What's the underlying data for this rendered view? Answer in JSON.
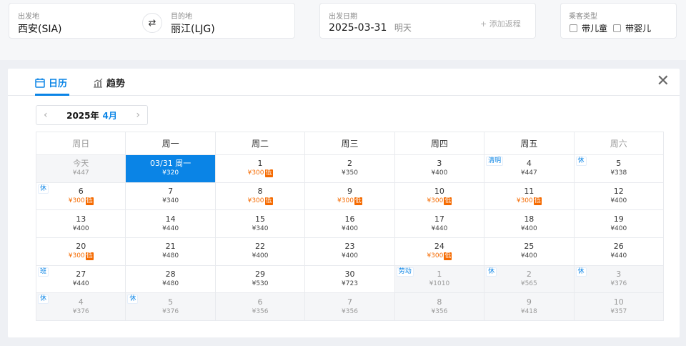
{
  "search": {
    "from_label": "出发地",
    "from_value": "西安(SIA)",
    "to_label": "目的地",
    "to_value": "丽江(LJG)",
    "date_label": "出发日期",
    "date_value": "2025-03-31",
    "date_note": "明天",
    "add_return": "+ 添加返程",
    "passenger_label": "乘客类型",
    "child_label": "带儿童",
    "infant_label": "带婴儿"
  },
  "tabs": {
    "calendar": "日历",
    "trend": "趋势"
  },
  "month_nav": {
    "year": "2025年",
    "month": "4月"
  },
  "weekdays": [
    "周日",
    "周一",
    "周二",
    "周三",
    "周四",
    "周五",
    "周六"
  ],
  "weeks": [
    [
      {
        "d": "今天",
        "p": "¥447",
        "today": true
      },
      {
        "d": "03/31 周一",
        "p": "¥320",
        "sel": true
      },
      {
        "d": "1",
        "p": "¥300",
        "low": true
      },
      {
        "d": "2",
        "p": "¥350"
      },
      {
        "d": "3",
        "p": "¥400"
      },
      {
        "d": "4",
        "p": "¥447",
        "tag": "清明"
      },
      {
        "d": "5",
        "p": "¥338",
        "tag": "休"
      }
    ],
    [
      {
        "d": "6",
        "p": "¥300",
        "low": true,
        "tag": "休"
      },
      {
        "d": "7",
        "p": "¥340"
      },
      {
        "d": "8",
        "p": "¥300",
        "low": true
      },
      {
        "d": "9",
        "p": "¥300",
        "low": true
      },
      {
        "d": "10",
        "p": "¥300",
        "low": true
      },
      {
        "d": "11",
        "p": "¥300",
        "low": true
      },
      {
        "d": "12",
        "p": "¥400"
      }
    ],
    [
      {
        "d": "13",
        "p": "¥400"
      },
      {
        "d": "14",
        "p": "¥440"
      },
      {
        "d": "15",
        "p": "¥340"
      },
      {
        "d": "16",
        "p": "¥400"
      },
      {
        "d": "17",
        "p": "¥440"
      },
      {
        "d": "18",
        "p": "¥400"
      },
      {
        "d": "19",
        "p": "¥400"
      }
    ],
    [
      {
        "d": "20",
        "p": "¥300",
        "low": true
      },
      {
        "d": "21",
        "p": "¥480"
      },
      {
        "d": "22",
        "p": "¥400"
      },
      {
        "d": "23",
        "p": "¥400"
      },
      {
        "d": "24",
        "p": "¥300",
        "low": true
      },
      {
        "d": "25",
        "p": "¥400"
      },
      {
        "d": "26",
        "p": "¥440"
      }
    ],
    [
      {
        "d": "27",
        "p": "¥440",
        "tag": "班"
      },
      {
        "d": "28",
        "p": "¥480"
      },
      {
        "d": "29",
        "p": "¥530"
      },
      {
        "d": "30",
        "p": "¥723"
      },
      {
        "d": "1",
        "p": "¥1010",
        "dim": true,
        "tag": "劳动"
      },
      {
        "d": "2",
        "p": "¥565",
        "dim": true,
        "tag": "休"
      },
      {
        "d": "3",
        "p": "¥376",
        "dim": true,
        "tag": "休"
      }
    ],
    [
      {
        "d": "4",
        "p": "¥376",
        "dim": true,
        "tag": "休"
      },
      {
        "d": "5",
        "p": "¥376",
        "dim": true,
        "tag": "休"
      },
      {
        "d": "6",
        "p": "¥356",
        "dim": true
      },
      {
        "d": "7",
        "p": "¥356",
        "dim": true
      },
      {
        "d": "8",
        "p": "¥356",
        "dim": true
      },
      {
        "d": "9",
        "p": "¥418",
        "dim": true
      },
      {
        "d": "10",
        "p": "¥357",
        "dim": true
      }
    ]
  ],
  "low_tag": "低",
  "colors": {
    "accent": "#0a84e6",
    "low": "#f56a00"
  }
}
